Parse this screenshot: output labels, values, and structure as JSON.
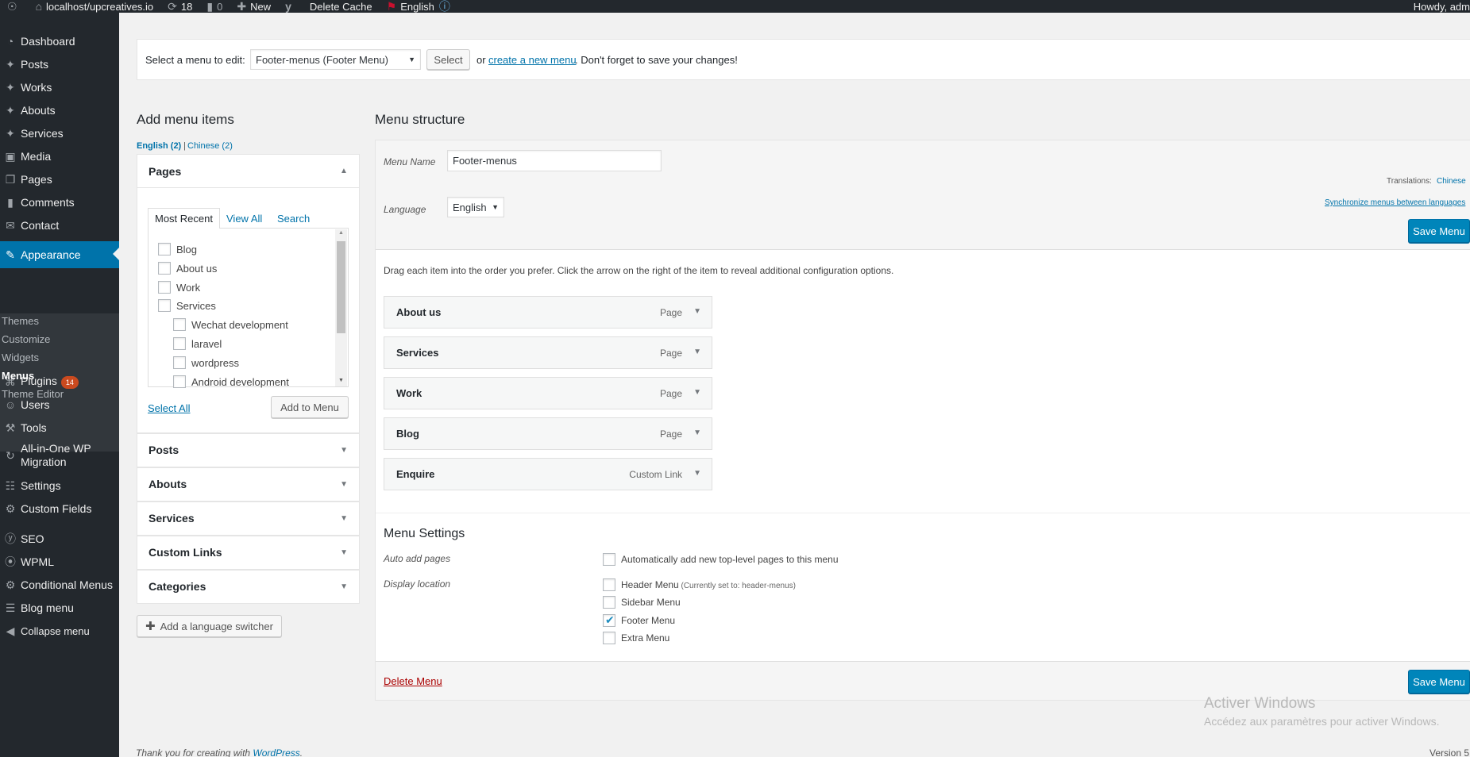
{
  "adminbar": {
    "site": "localhost/upcreatives.io",
    "updates": "18",
    "comments": "0",
    "new": "New",
    "delete_cache": "Delete Cache",
    "language": "English",
    "howdy": "Howdy, adm"
  },
  "sidebar": {
    "items": [
      {
        "label": "Dashboard",
        "icon": "dashboard-icon"
      },
      {
        "label": "Posts",
        "icon": "pin-icon"
      },
      {
        "label": "Works",
        "icon": "pin-icon"
      },
      {
        "label": "Abouts",
        "icon": "pin-icon"
      },
      {
        "label": "Services",
        "icon": "pin-icon"
      },
      {
        "label": "Media",
        "icon": "media-icon"
      },
      {
        "label": "Pages",
        "icon": "pages-icon"
      },
      {
        "label": "Comments",
        "icon": "comments-icon"
      },
      {
        "label": "Contact",
        "icon": "mail-icon"
      },
      {
        "label": "Appearance",
        "icon": "brush-icon"
      },
      {
        "label": "Plugins",
        "icon": "plugin-icon",
        "badge": "14"
      },
      {
        "label": "Users",
        "icon": "users-icon"
      },
      {
        "label": "Tools",
        "icon": "tools-icon"
      },
      {
        "label": "All-in-One WP",
        "label2": "Migration",
        "icon": "migration-icon"
      },
      {
        "label": "Settings",
        "icon": "settings-icon"
      },
      {
        "label": "Custom Fields",
        "icon": "gear-icon"
      },
      {
        "label": "SEO",
        "icon": "seo-icon"
      },
      {
        "label": "WPML",
        "icon": "wpml-icon"
      },
      {
        "label": "Conditional Menus",
        "icon": "gear-icon"
      },
      {
        "label": "Blog menu",
        "icon": "blog-icon"
      },
      {
        "label": "Collapse menu",
        "icon": "collapse-icon"
      }
    ],
    "submenu": [
      "Themes",
      "Customize",
      "Widgets",
      "Menus",
      "Theme Editor"
    ]
  },
  "select_menu": {
    "label": "Select a menu to edit:",
    "selected": "Footer-menus (Footer Menu)",
    "select_button": "Select",
    "or": "or",
    "create_link": "create a new menu",
    "suffix": ". Don't forget to save your changes!"
  },
  "add_items": {
    "heading": "Add menu items",
    "lang_english": "English (2)",
    "separator": "|",
    "lang_chinese": "Chinese (2)",
    "pages_title": "Pages",
    "tabs": [
      "Most Recent",
      "View All",
      "Search"
    ],
    "pages": [
      {
        "label": "Blog",
        "indent": false
      },
      {
        "label": "About us",
        "indent": false
      },
      {
        "label": "Work",
        "indent": false
      },
      {
        "label": "Services",
        "indent": false
      },
      {
        "label": "Wechat development",
        "indent": true
      },
      {
        "label": "laravel",
        "indent": true
      },
      {
        "label": "wordpress",
        "indent": true
      },
      {
        "label": "Android development",
        "indent": true
      }
    ],
    "select_all": "Select All",
    "add_to_menu": "Add to Menu",
    "accordions": [
      "Posts",
      "Abouts",
      "Services",
      "Custom Links",
      "Categories"
    ],
    "language_switcher": "Add a language switcher"
  },
  "structure": {
    "heading": "Menu structure",
    "menu_name_label": "Menu Name",
    "menu_name_value": "Footer-menus",
    "language_label": "Language",
    "language_value": "English",
    "translations_label": "Translations:",
    "translations_value": "Chinese",
    "sync_link": "Synchronize menus between languages",
    "save_menu": "Save Menu",
    "instructions": "Drag each item into the order you prefer. Click the arrow on the right of the item to reveal additional configuration options.",
    "items": [
      {
        "title": "About us",
        "type": "Page"
      },
      {
        "title": "Services",
        "type": "Page"
      },
      {
        "title": "Work",
        "type": "Page"
      },
      {
        "title": "Blog",
        "type": "Page"
      },
      {
        "title": "Enquire",
        "type": "Custom Link"
      }
    ],
    "settings_heading": "Menu Settings",
    "auto_add_label": "Auto add pages",
    "auto_add_option": "Automatically add new top-level pages to this menu",
    "display_location_label": "Display location",
    "locations": [
      {
        "label": "Header Menu",
        "note": "(Currently set to: header-menus)",
        "checked": false
      },
      {
        "label": "Sidebar Menu",
        "note": "",
        "checked": false
      },
      {
        "label": "Footer Menu",
        "note": "",
        "checked": true
      },
      {
        "label": "Extra Menu",
        "note": "",
        "checked": false
      }
    ],
    "delete_menu": "Delete Menu",
    "save_menu_bottom": "Save Menu"
  },
  "footer": {
    "thanks": "Thank you for creating with",
    "wp_link": "WordPress",
    "period": ".",
    "version": "Version 5"
  },
  "watermark": {
    "line1": "Activer Windows",
    "line2": "Accédez aux paramètres pour activer Windows."
  }
}
